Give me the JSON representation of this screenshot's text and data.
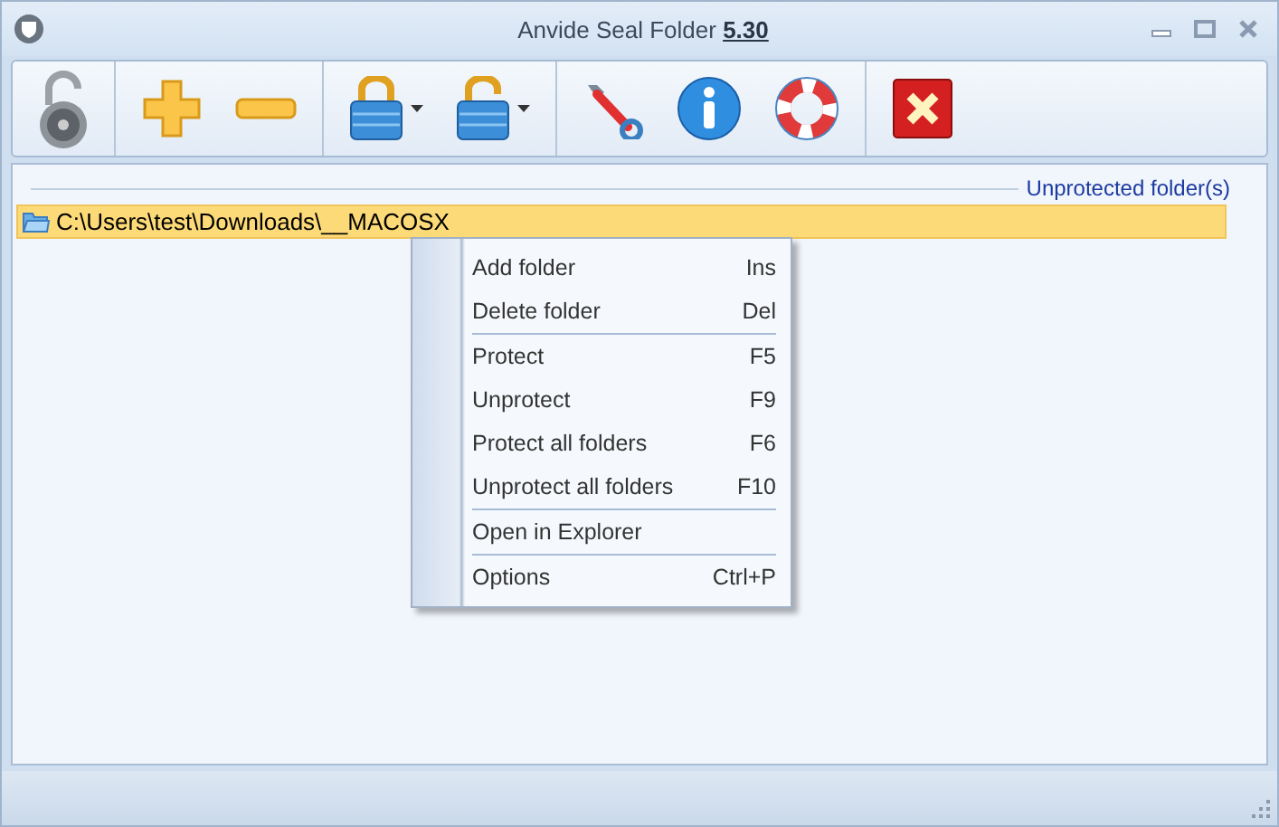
{
  "window": {
    "title": "Anvide Seal Folder",
    "version": "5.30"
  },
  "toolbar": {
    "groups": [
      {
        "buttons": [
          {
            "kind": "open-lock"
          }
        ]
      },
      {
        "buttons": [
          {
            "kind": "plus"
          },
          {
            "kind": "minus"
          }
        ]
      },
      {
        "buttons": [
          {
            "kind": "blue-lock",
            "dropdown": true
          },
          {
            "kind": "blue-open-lock",
            "dropdown": true
          }
        ]
      },
      {
        "buttons": [
          {
            "kind": "wrench"
          },
          {
            "kind": "info"
          },
          {
            "kind": "lifebuoy"
          }
        ]
      },
      {
        "buttons": [
          {
            "kind": "exit"
          }
        ]
      }
    ]
  },
  "section_label": "Unprotected folder(s)",
  "folders": [
    {
      "path": "C:\\Users\\test\\Downloads\\__MACOSX",
      "selected": true
    }
  ],
  "context_menu": [
    {
      "label": "Add folder",
      "shortcut": "Ins"
    },
    {
      "label": "Delete folder",
      "shortcut": "Del"
    },
    {
      "label": "Protect",
      "shortcut": "F5",
      "separator_before": true
    },
    {
      "label": "Unprotect",
      "shortcut": "F9"
    },
    {
      "label": "Protect all folders",
      "shortcut": "F6"
    },
    {
      "label": "Unprotect all folders",
      "shortcut": "F10"
    },
    {
      "label": "Open in Explorer",
      "separator_before": true
    },
    {
      "label": "Options",
      "shortcut": "Ctrl+P",
      "separator_before": true
    }
  ]
}
